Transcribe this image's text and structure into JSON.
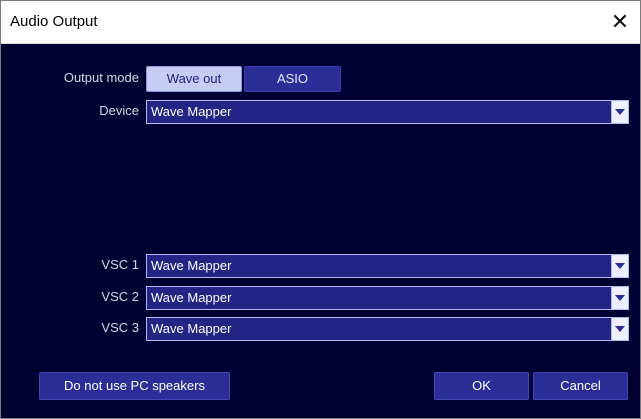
{
  "window": {
    "title": "Audio Output"
  },
  "output_mode": {
    "label": "Output mode",
    "options": [
      "Wave out",
      "ASIO"
    ],
    "selected": "Wave out"
  },
  "device": {
    "label": "Device",
    "value": "Wave Mapper"
  },
  "vsc": [
    {
      "label": "VSC 1",
      "value": "Wave Mapper"
    },
    {
      "label": "VSC 2",
      "value": "Wave Mapper"
    },
    {
      "label": "VSC 3",
      "value": "Wave Mapper"
    }
  ],
  "buttons": {
    "speakers": "Do not use PC speakers",
    "ok": "OK",
    "cancel": "Cancel"
  },
  "icons": {
    "close": "close-icon",
    "dropdown": "chevron-down-icon"
  },
  "colors": {
    "background": "#000032",
    "combo": "#232585",
    "button": "#2a2e96",
    "active_segment": "#c7ccf5"
  }
}
